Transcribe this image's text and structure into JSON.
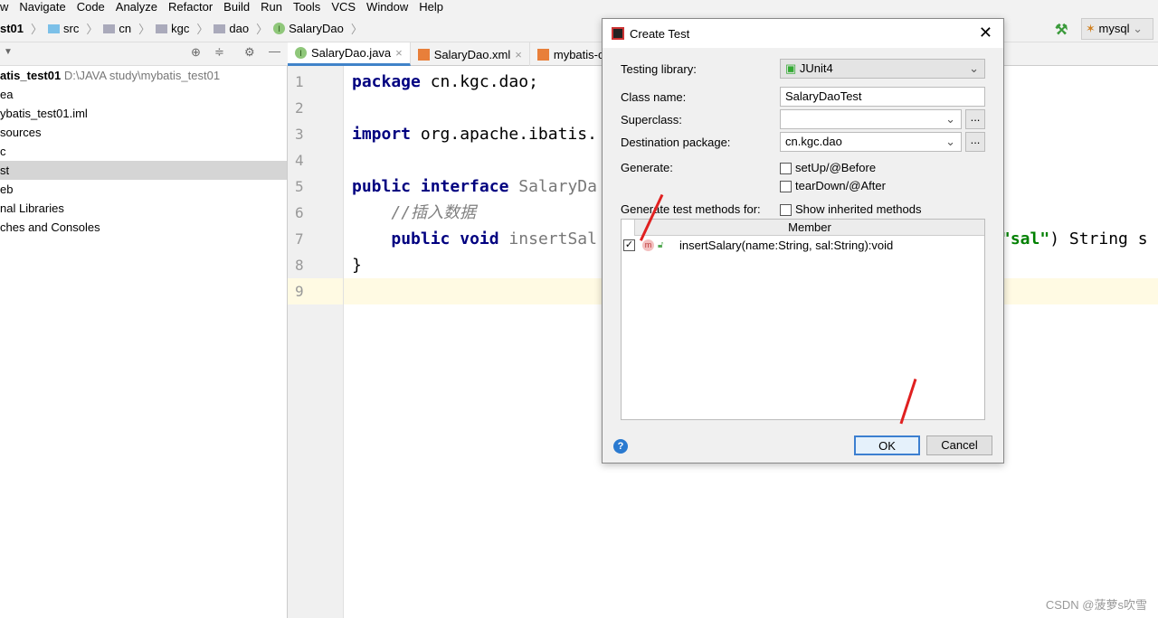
{
  "menu": [
    "w",
    "Navigate",
    "Code",
    "Analyze",
    "Refactor",
    "Build",
    "Run",
    "Tools",
    "VCS",
    "Window",
    "Help"
  ],
  "breadcrumb": [
    "st01",
    "src",
    "cn",
    "kgc",
    "dao",
    "SalaryDao"
  ],
  "run_config": "mysql",
  "project": {
    "root": "atis_test01",
    "root_path": "D:\\JAVA study\\mybatis_test01",
    "items": [
      "ea",
      "ybatis_test01.iml",
      "sources",
      "c",
      "st",
      "eb",
      "nal Libraries",
      "ches and Consoles"
    ]
  },
  "tabs": [
    "SalaryDao.java",
    "SalaryDao.xml",
    "mybatis-c"
  ],
  "code": {
    "line_numbers": [
      "1",
      "2",
      "3",
      "4",
      "5",
      "6",
      "7",
      "8",
      "9"
    ],
    "l1_kw": "package",
    "l1": " cn.kgc.dao;",
    "l3_kw": "import",
    "l3": " org.apache.ibatis.",
    "l5_kw1": "public",
    "l5_kw2": "interface",
    "l5": " SalaryDa",
    "l6": "//插入数据",
    "l7_kw1": "public",
    "l7_kw2": "void",
    "l7": " insertSal",
    "l7_str": "\"sal\"",
    "l7_rest": ") String s",
    "l8": "}"
  },
  "dialog": {
    "title": "Create Test",
    "testing_library_label": "Testing library:",
    "testing_library": "JUnit4",
    "class_name_label": "Class name:",
    "class_name": "SalaryDaoTest",
    "superclass_label": "Superclass:",
    "superclass": "",
    "dest_label": "Destination package:",
    "dest": "cn.kgc.dao",
    "generate_label": "Generate:",
    "setup": "setUp/@Before",
    "teardown": "tearDown/@After",
    "methods_label": "Generate test methods for:",
    "show_inherited": "Show inherited methods",
    "member_header": "Member",
    "member": "insertSalary(name:String, sal:String):void",
    "ok": "OK",
    "cancel": "Cancel",
    "help": "?"
  },
  "watermark": "CSDN @菠萝s吹雪"
}
